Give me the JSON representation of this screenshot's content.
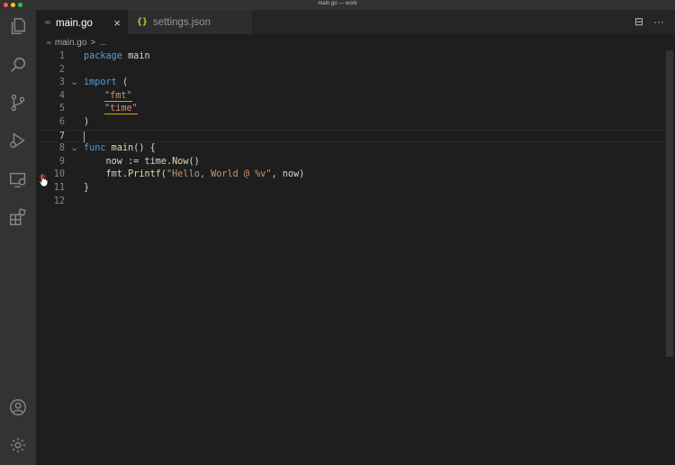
{
  "window": {
    "title": "main.go — work"
  },
  "activity_bar": {
    "icons": [
      "explorer-icon",
      "search-icon",
      "source-control-icon",
      "run-debug-icon",
      "remote-explorer-icon",
      "extensions-icon",
      "account-icon",
      "settings-gear-icon"
    ]
  },
  "tabs": [
    {
      "label": "main.go",
      "icon": "∞",
      "active": true
    },
    {
      "label": "settings.json",
      "icon": "{}",
      "active": false
    }
  ],
  "tab_actions": {
    "split": "⊟",
    "more": "···"
  },
  "breadcrumb": {
    "file": "main.go",
    "sep": ">",
    "more": "..."
  },
  "editor": {
    "active_line": 7,
    "breakpoint_line": 10,
    "lines": [
      {
        "n": "1"
      },
      {
        "n": "2"
      },
      {
        "n": "3"
      },
      {
        "n": "4"
      },
      {
        "n": "5"
      },
      {
        "n": "6"
      },
      {
        "n": "7"
      },
      {
        "n": "8"
      },
      {
        "n": "9"
      },
      {
        "n": "10"
      },
      {
        "n": "11"
      },
      {
        "n": "12"
      }
    ],
    "tokens": {
      "l1_kw": "package",
      "l1_id": " main",
      "l3_kw": "import",
      "l3_p": " (",
      "l4_str": "\"fmt\"",
      "l5_str": "\"time\"",
      "l6": ")",
      "l8_kw": "func",
      "l8_fn": " main",
      "l8_p": "() {",
      "l9_a": "    now := time.",
      "l9_fn": "Now",
      "l9_b": "()",
      "l10_a": "    fmt.",
      "l10_fn": "Printf",
      "l10_b": "(",
      "l10_str": "\"Hello, World @ %v\"",
      "l10_c": ", now)",
      "l11": "}"
    }
  }
}
